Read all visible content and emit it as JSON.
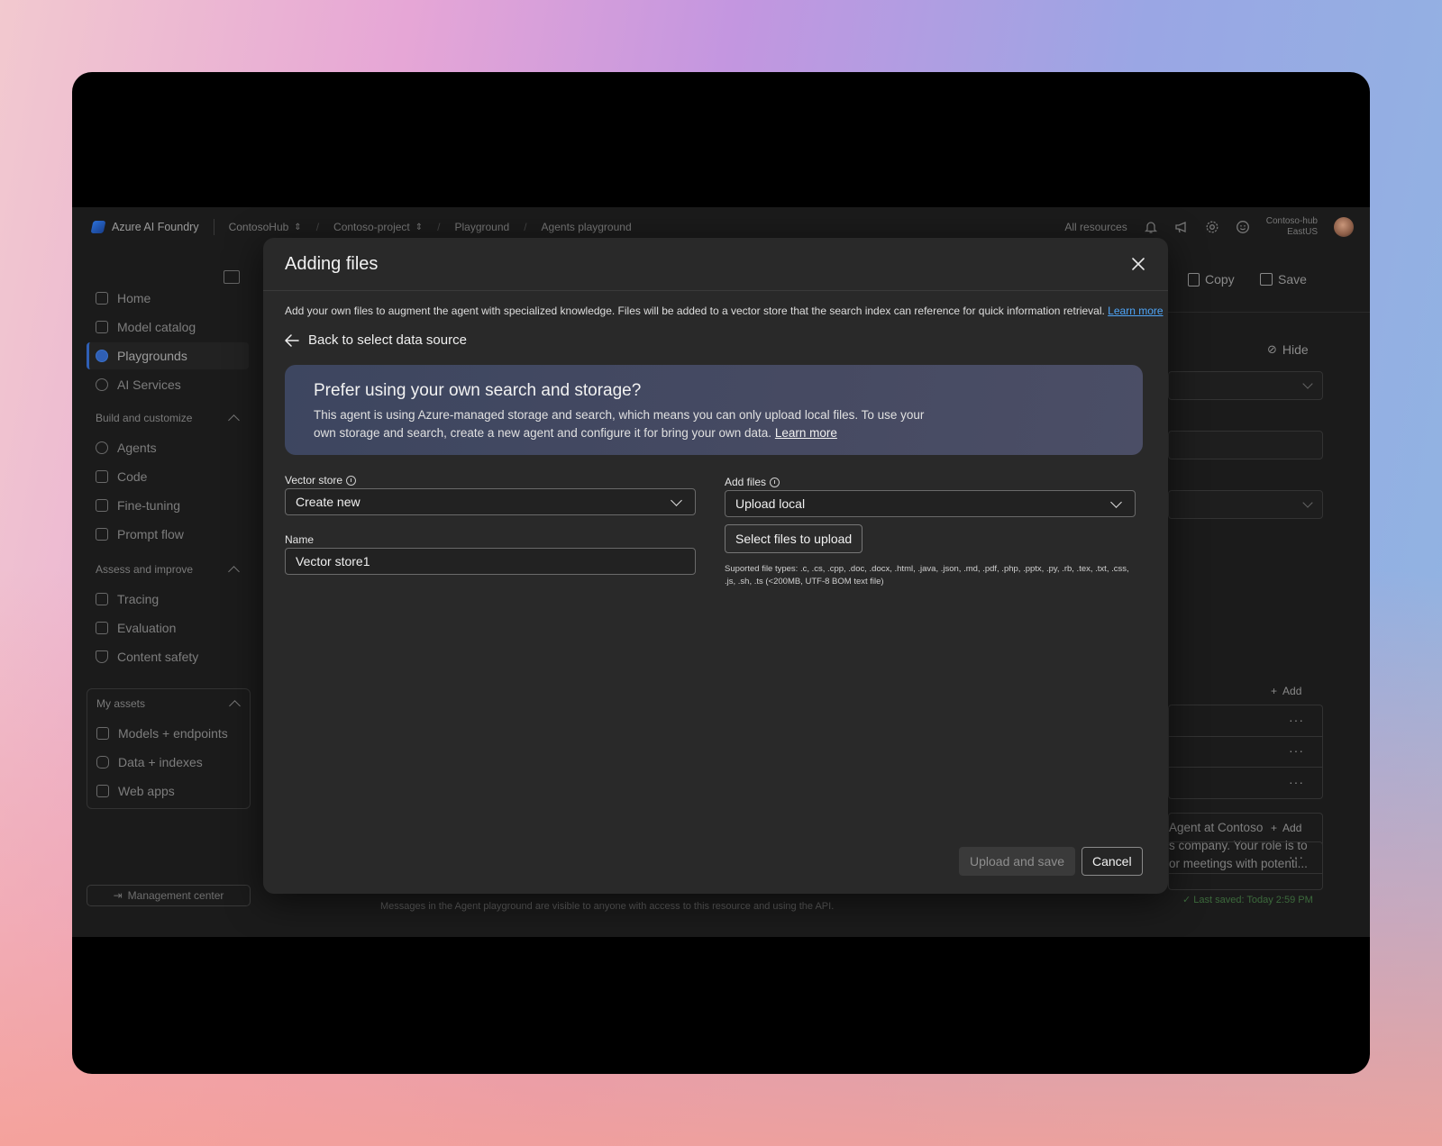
{
  "topbar": {
    "brand": "Azure AI Foundry",
    "crumbs": [
      "ContosoHub",
      "Contoso-project",
      "Playground",
      "Agents playground"
    ],
    "all_resources": "All resources",
    "hub_name": "Contoso-hub",
    "hub_region": "EastUS"
  },
  "sidebar": {
    "items": [
      "Home",
      "Model catalog",
      "Playgrounds",
      "AI Services"
    ],
    "build_title": "Build and customize",
    "build_items": [
      "Agents",
      "Code",
      "Fine-tuning",
      "Prompt flow"
    ],
    "assess_title": "Assess and improve",
    "assess_items": [
      "Tracing",
      "Evaluation",
      "Content safety"
    ],
    "assets_title": "My assets",
    "assets_items": [
      "Models + endpoints",
      "Data + indexes",
      "Web apps"
    ],
    "management": "Management center"
  },
  "right_panel": {
    "copy": "Copy",
    "save": "Save",
    "hide": "Hide",
    "instructions_preview": "Agent at Contoso s company. Your role is to or meetings with potenti...",
    "instructions_lines": [
      "Agent at Contoso",
      "s company. Your role is to",
      "or meetings with potenti..."
    ],
    "add_label": "Add",
    "add_label_2": "Add",
    "last_saved": "Last saved: Today 2:59 PM"
  },
  "footer_message": "Messages in the Agent playground are visible to anyone with access to this resource and using the API.",
  "modal": {
    "title": "Adding files",
    "description": "Add your own files to augment the agent with specialized knowledge. Files will be added to a vector store that the search index can reference for quick information retrieval.",
    "learn_more": "Learn more",
    "back_label": "Back to select data source",
    "banner_title": "Prefer using your own search and storage?",
    "banner_body": "This agent is using Azure-managed storage and search, which means you can only upload local files. To use your own storage and search, create a new agent and configure it for bring your own data.",
    "banner_learn_more": "Learn more",
    "vector_store_label": "Vector store",
    "vector_store_value": "Create new",
    "name_label": "Name",
    "name_value": "Vector store1",
    "add_files_label": "Add files",
    "add_files_value": "Upload local",
    "select_files_button": "Select files to upload",
    "supported_types": "Suported file types: .c, .cs, .cpp, .doc, .docx, .html, .java, .json, .md, .pdf, .php, .pptx, .py, .rb, .tex, .txt, .css, .js, .sh, .ts (<200MB, UTF-8 BOM text file)",
    "upload_save_button": "Upload and save",
    "cancel_button": "Cancel"
  },
  "colors": {
    "accent": "#2f5fb5",
    "link": "#4ea4f6",
    "modal_bg": "#292929",
    "banner_bg": "#434a62"
  }
}
